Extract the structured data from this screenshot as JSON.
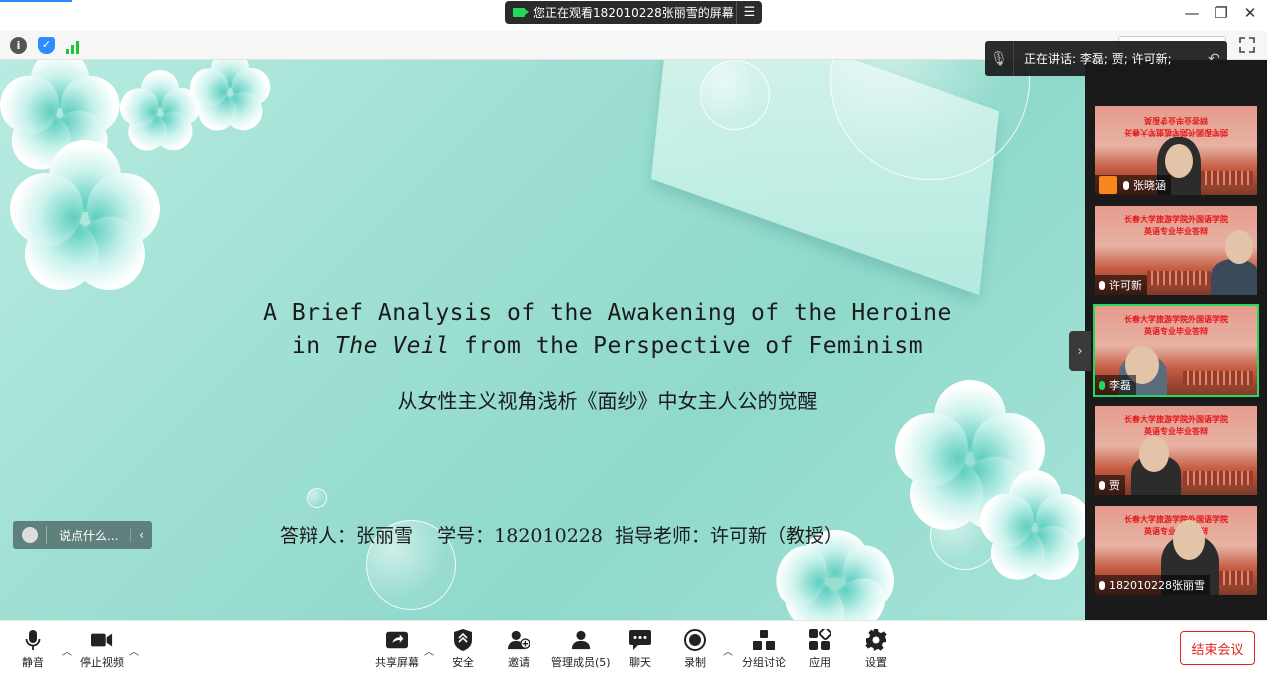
{
  "window": {
    "viewing_banner": "您正在观看182010228张丽雪的屏幕",
    "minimize_glyph": "—",
    "restore_glyph": "❐",
    "close_glyph": "✕"
  },
  "speaking_indicator": {
    "label": "正在讲话: 李磊; 贾; 许可新;"
  },
  "chat_box": {
    "placeholder": "说点什么..."
  },
  "slide": {
    "title_line1": "A Brief Analysis of the Awakening of the Heroine",
    "title_line2_prefix": "in ",
    "title_line2_italic": "The Veil",
    "title_line2_suffix": " from the Perspective of Feminism",
    "subtitle_cn": "从女性主义视角浅析《面纱》中女主人公的觉醒",
    "info_line": "答辩人：张丽雪    学号：182010228  指导老师：许可新（教授）"
  },
  "participants": [
    {
      "name": "张晓涵",
      "banner": "长春大学旅游学院外国语学院\n英语专业毕业答辩",
      "active": false,
      "has_avatar": true,
      "mic_color": "#ffffff"
    },
    {
      "name": "许可新",
      "banner": "长春大学旅游学院外国语学院\n英语专业毕业答辩",
      "active": false,
      "has_avatar": false,
      "mic_color": "#ffffff"
    },
    {
      "name": "李磊",
      "banner": "长春大学旅游学院外国语学院\n英语专业毕业答辩",
      "active": true,
      "has_avatar": false,
      "mic_color": "#23d959"
    },
    {
      "name": "贾",
      "banner": "长春大学旅游学院外国语学院\n英语专业毕业答辩",
      "active": false,
      "has_avatar": false,
      "mic_color": "#ffffff"
    },
    {
      "name": "182010228张丽雪",
      "banner": "长春大学旅游学院外国语学院\n英语专业毕业答辩",
      "active": false,
      "has_avatar": false,
      "mic_color": "#ffffff"
    }
  ],
  "bottom_bar": {
    "mute": "静音",
    "stop_video": "停止视频",
    "share_screen": "共享屏幕",
    "security": "安全",
    "invite": "邀请",
    "manage_participants": "管理成员(5)",
    "chat": "聊天",
    "record": "录制",
    "breakout": "分组讨论",
    "apps": "应用",
    "settings": "设置",
    "end_meeting": "结束会议"
  },
  "colors": {
    "accent_blue": "#2d8cff",
    "active_green": "#23d959",
    "end_red": "#e0251b"
  }
}
